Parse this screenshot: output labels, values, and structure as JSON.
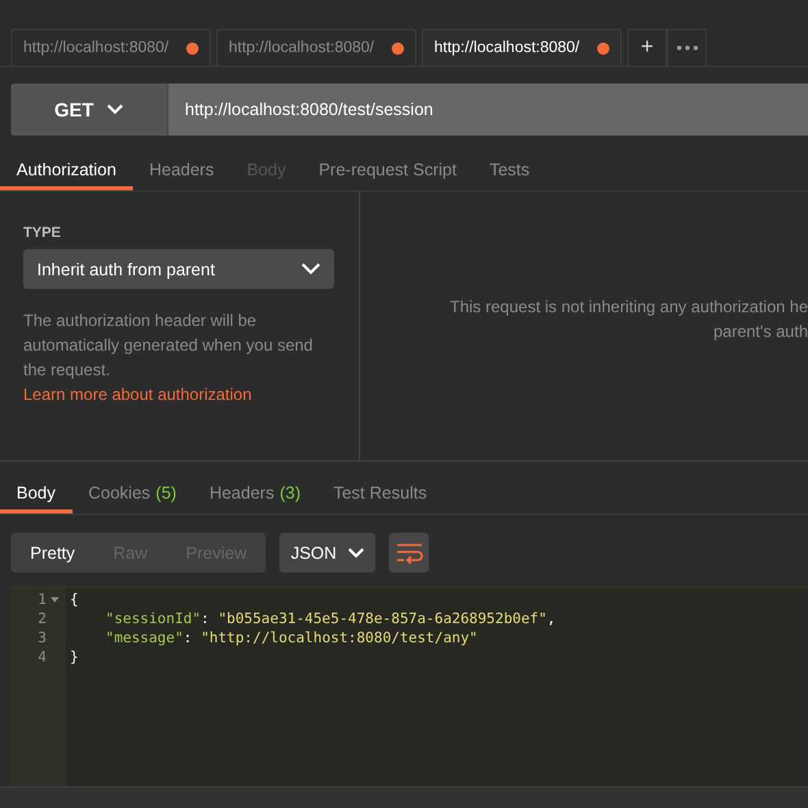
{
  "request_tabs": [
    {
      "label": "http://localhost:8080/",
      "selected": false,
      "unsaved": true
    },
    {
      "label": "http://localhost:8080/",
      "selected": false,
      "unsaved": true
    },
    {
      "label": "http://localhost:8080/",
      "selected": true,
      "unsaved": true
    }
  ],
  "new_tab_button": "+",
  "request": {
    "method": "GET",
    "url": "http://localhost:8080/test/session"
  },
  "request_sections": [
    {
      "label": "Authorization",
      "selected": true,
      "disabled": false
    },
    {
      "label": "Headers",
      "selected": false,
      "disabled": false
    },
    {
      "label": "Body",
      "selected": false,
      "disabled": true
    },
    {
      "label": "Pre-request Script",
      "selected": false,
      "disabled": false
    },
    {
      "label": "Tests",
      "selected": false,
      "disabled": false
    }
  ],
  "authorization": {
    "type_label": "TYPE",
    "type_value": "Inherit auth from parent",
    "help_text": "The authorization header will be automatically generated when you send the request.",
    "help_link": "Learn more about authorization",
    "message_lines": [
      "This request is not inheriting any authorization he",
      "parent's auth"
    ]
  },
  "response_sections": [
    {
      "label": "Body",
      "selected": true
    },
    {
      "label": "Cookies",
      "count": "(5)",
      "selected": false
    },
    {
      "label": "Headers",
      "count": "(3)",
      "selected": false
    },
    {
      "label": "Test Results",
      "selected": false
    }
  ],
  "view_modes": [
    {
      "label": "Pretty",
      "selected": true
    },
    {
      "label": "Raw",
      "selected": false
    },
    {
      "label": "Preview",
      "selected": false
    }
  ],
  "format": "JSON",
  "wrap_enabled": true,
  "code_lines": [
    {
      "number": "1",
      "foldable": true,
      "indented": false,
      "tokens": [
        {
          "kind": "punct",
          "text": "{"
        }
      ]
    },
    {
      "number": "2",
      "foldable": false,
      "indented": true,
      "tokens": [
        {
          "kind": "key",
          "text": "\"sessionId\""
        },
        {
          "kind": "punct",
          "text": ": "
        },
        {
          "kind": "string",
          "text": "\"b055ae31-45e5-478e-857a-6a268952b0ef\""
        },
        {
          "kind": "punct",
          "text": ","
        }
      ]
    },
    {
      "number": "3",
      "foldable": false,
      "indented": true,
      "tokens": [
        {
          "kind": "key",
          "text": "\"message\""
        },
        {
          "kind": "punct",
          "text": ": "
        },
        {
          "kind": "string",
          "text": "\"http://localhost:8080/test/any\""
        }
      ]
    },
    {
      "number": "4",
      "foldable": false,
      "indented": false,
      "tokens": [
        {
          "kind": "punct",
          "text": "}"
        }
      ]
    }
  ]
}
